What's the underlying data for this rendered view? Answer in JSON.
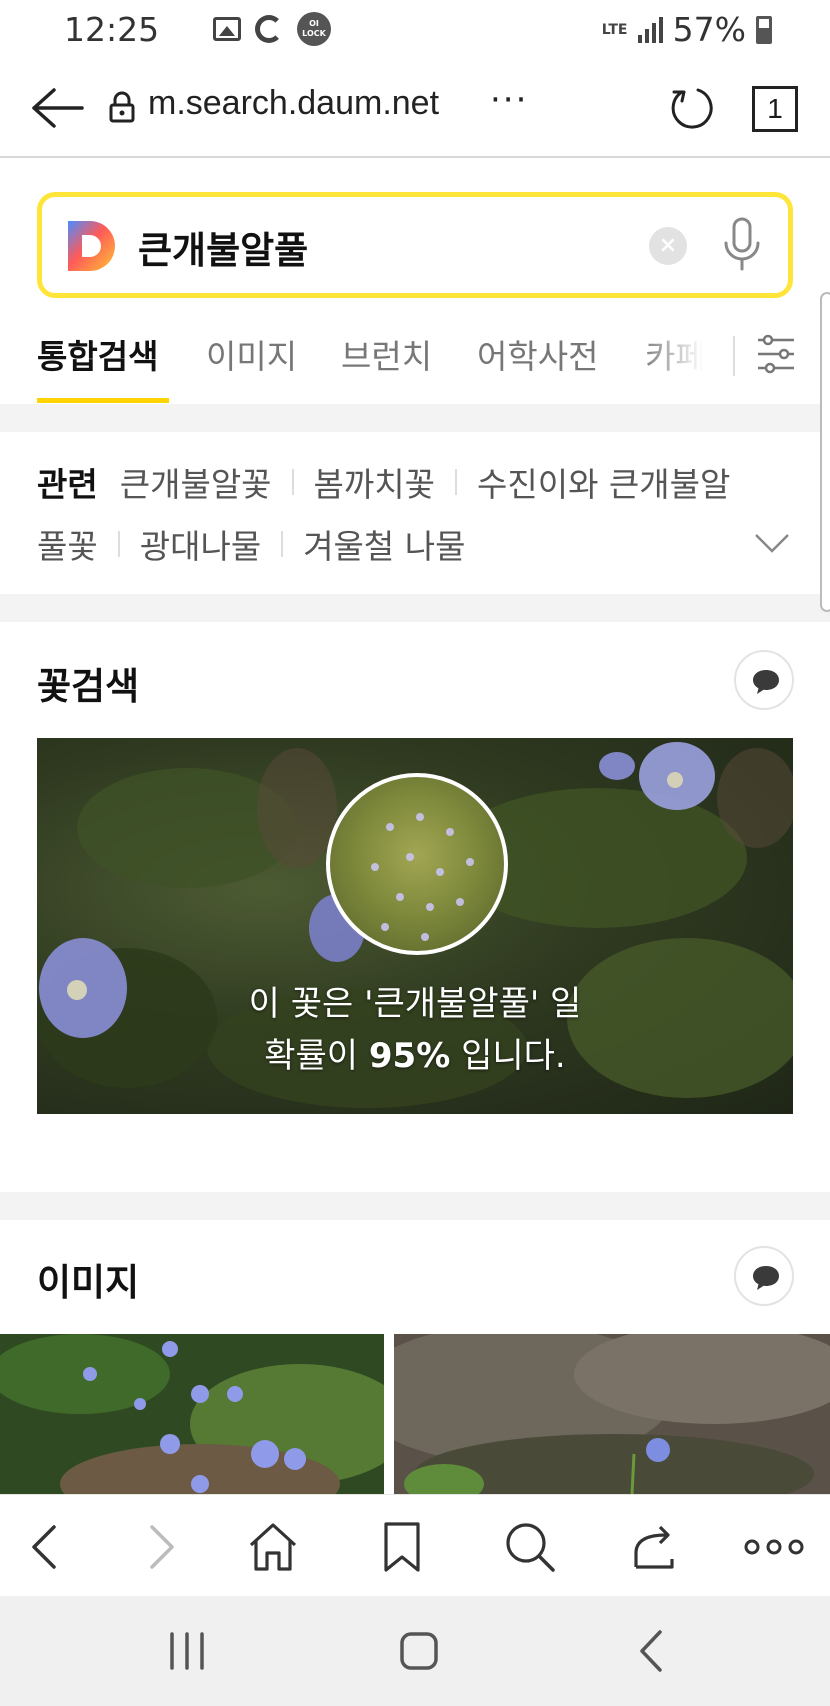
{
  "status_bar": {
    "time": "12:25",
    "lock_badge": "OI LOCK",
    "network": "LTE",
    "battery_percent": "57%"
  },
  "browser": {
    "url": "m.search.daum.net",
    "url_more": "···",
    "tab_count": "1"
  },
  "search": {
    "query": "큰개불알풀",
    "clear_symbol": "×"
  },
  "tabs": [
    {
      "label": "통합검색",
      "active": true
    },
    {
      "label": "이미지"
    },
    {
      "label": "브런치"
    },
    {
      "label": "어학사전"
    },
    {
      "label": "카페"
    }
  ],
  "related": {
    "heading": "관련",
    "items": [
      "큰개불알꽃",
      "봄까치꽃",
      "수진이와 큰개불알",
      "풀꽃",
      "광대나물",
      "겨울철 나물"
    ]
  },
  "flower_search": {
    "title": "꽃검색",
    "result_line1": "이 꽃은 '큰개불알풀' 일",
    "result_prefix": "확률이 ",
    "probability": "95%",
    "result_suffix": " 입니다."
  },
  "images_section": {
    "title": "이미지"
  },
  "colors": {
    "search_border": "#ffe53a",
    "tab_underline": "#ffd400",
    "section_gap": "#f3f3f3"
  }
}
